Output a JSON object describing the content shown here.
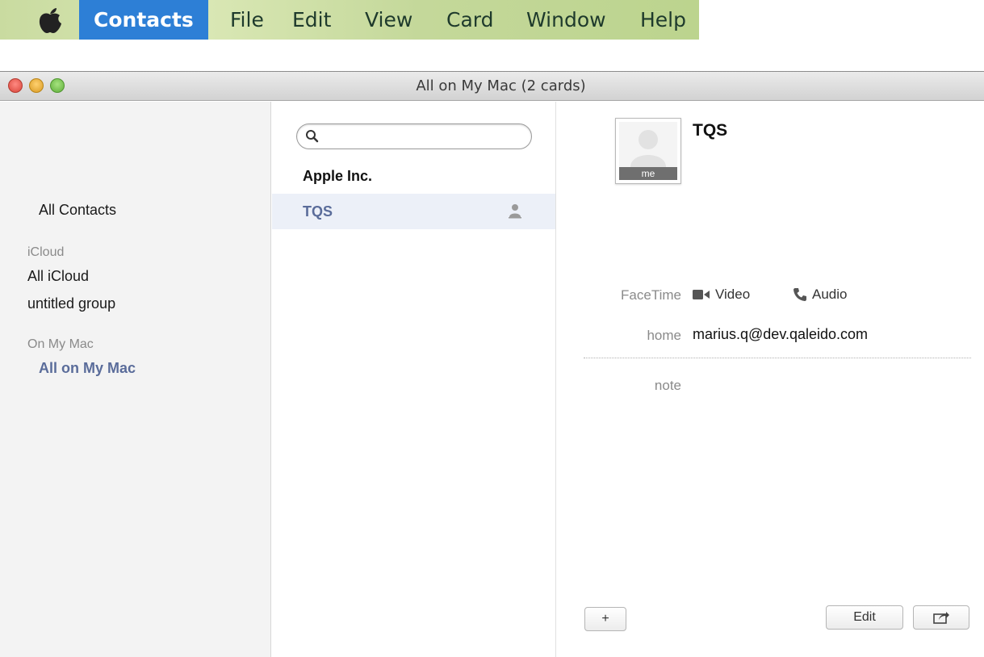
{
  "menubar": {
    "app": "Contacts",
    "items": [
      "File",
      "Edit",
      "View",
      "Card",
      "Window",
      "Help"
    ]
  },
  "window": {
    "title": "All on My Mac (2 cards)"
  },
  "groups": {
    "all_contacts": "All Contacts",
    "sections": [
      {
        "header": "iCloud",
        "items": [
          "All iCloud",
          "untitled group"
        ]
      },
      {
        "header": "On My Mac",
        "items": [
          "All on My Mac"
        ]
      }
    ],
    "selected": "All on My Mac"
  },
  "search": {
    "value": "",
    "placeholder": ""
  },
  "contacts": [
    {
      "name": "Apple Inc.",
      "selected": false,
      "is_me": false
    },
    {
      "name": "TQS",
      "selected": true,
      "is_me": true
    }
  ],
  "card": {
    "name": "TQS",
    "me_tag": "me",
    "facetime_label": "FaceTime",
    "facetime_video": "Video",
    "facetime_audio": "Audio",
    "email_label": "home",
    "email_value": "marius.q@dev.qaleido.com",
    "note_label": "note",
    "add_button": "+",
    "edit_button": "Edit"
  },
  "colors": {
    "menu_active": "#2d7fd6",
    "selected_text": "#5a6c9a",
    "selected_row": "#ecf0f8"
  }
}
